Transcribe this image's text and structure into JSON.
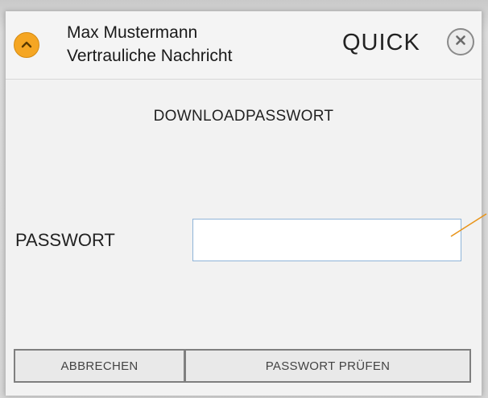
{
  "header": {
    "sender_name": "Max Mustermann",
    "subtitle": "Vertrauliche Nachricht",
    "brand": "QUICK"
  },
  "dialog": {
    "section_title": "DOWNLOADPASSWORT",
    "password_label": "PASSWORT",
    "password_value": "",
    "cancel_label": "ABBRECHEN",
    "check_label": "PASSWORT PRÜFEN"
  },
  "icons": {
    "collapse": "chevron-up-icon",
    "close": "close-icon"
  },
  "colors": {
    "accent": "#f5a623",
    "callout_line": "#e8941a",
    "input_border": "#8fb4d8"
  }
}
